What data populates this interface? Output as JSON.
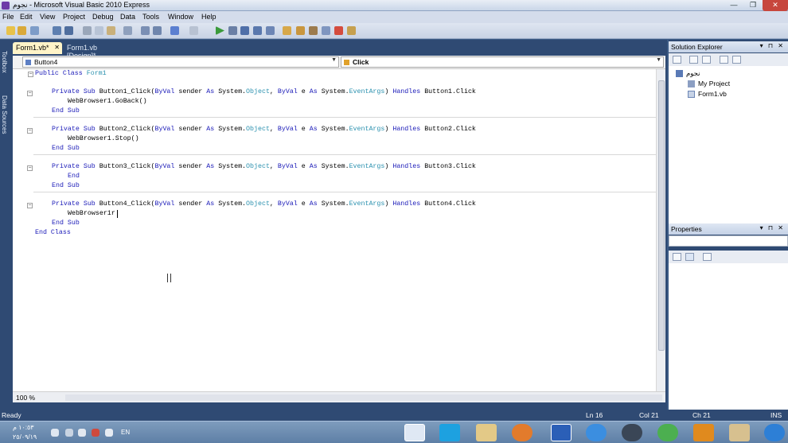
{
  "window": {
    "title": "نجوم - Microsoft Visual Basic 2010 Express",
    "min_glyph": "—",
    "max_glyph": "❐",
    "close_glyph": "✕"
  },
  "menu": [
    "File",
    "Edit",
    "View",
    "Project",
    "Debug",
    "Data",
    "Tools",
    "Window",
    "Help"
  ],
  "tabs": [
    {
      "label": "Form1.vb*",
      "active": true,
      "close_glyph": "✕"
    },
    {
      "label": "Form1.vb [Design]*",
      "active": false
    }
  ],
  "left_strip": [
    "Toolbox",
    "Data Sources"
  ],
  "nav": {
    "object": "Button4",
    "event": "Click"
  },
  "code": {
    "l1a": "Public",
    "l1b": " Class ",
    "l1c": "Form1",
    "s1_private": "Private",
    "s1_sub": "Sub",
    "s1_name": "Button1_Click(",
    "byval": "ByVal",
    "sender": "sender",
    "as": "As",
    "sys": "System.",
    "obj": "Object",
    "comma": ",",
    "e": "e",
    "eventargs": "EventArgs",
    "rparen": ")",
    "handles": "Handles",
    "b1": "Button1.Click",
    "s1_body": "WebBrowser1.GoBack()",
    "endsub": "End",
    "subkw": "Sub",
    "s2_name": "Button2_Click(",
    "b2": "Button2.Click",
    "s2_body": "WebBrowser1.Stop()",
    "s3_name": "Button3_Click(",
    "b3": "Button3.Click",
    "s3_body": "End",
    "s4_name": "Button4_Click(",
    "b4": "Button4.Click",
    "s4_body": "WebBrowser1r",
    "endclass_a": "End",
    "endclass_b": "Class",
    "collapse_glyph": "⊟"
  },
  "zoom": "100 %",
  "solution_explorer": {
    "title": "Solution Explorer",
    "pin": "▾ ⊓ ✕",
    "root": "نجوم",
    "items": [
      "My Project",
      "Form1.vb"
    ]
  },
  "properties": {
    "title": "Properties",
    "pin": "▾ ⊓ ✕"
  },
  "status": {
    "ready": "Ready",
    "ln": "Ln 16",
    "col": "Col 21",
    "ch": "Ch 21",
    "ins": "INS"
  },
  "tray": {
    "time": "١٠:٥٣ م",
    "date": "٢٥/٠٩/١٩",
    "lang": "EN"
  },
  "taskbar_apps": [
    "vb-icon",
    "skype-icon",
    "folder-icon",
    "firefox-icon",
    "snip-icon",
    "ie-icon",
    "steam-icon",
    "chrome-icon",
    "media-icon",
    "explorer-icon",
    "windows-icon"
  ]
}
